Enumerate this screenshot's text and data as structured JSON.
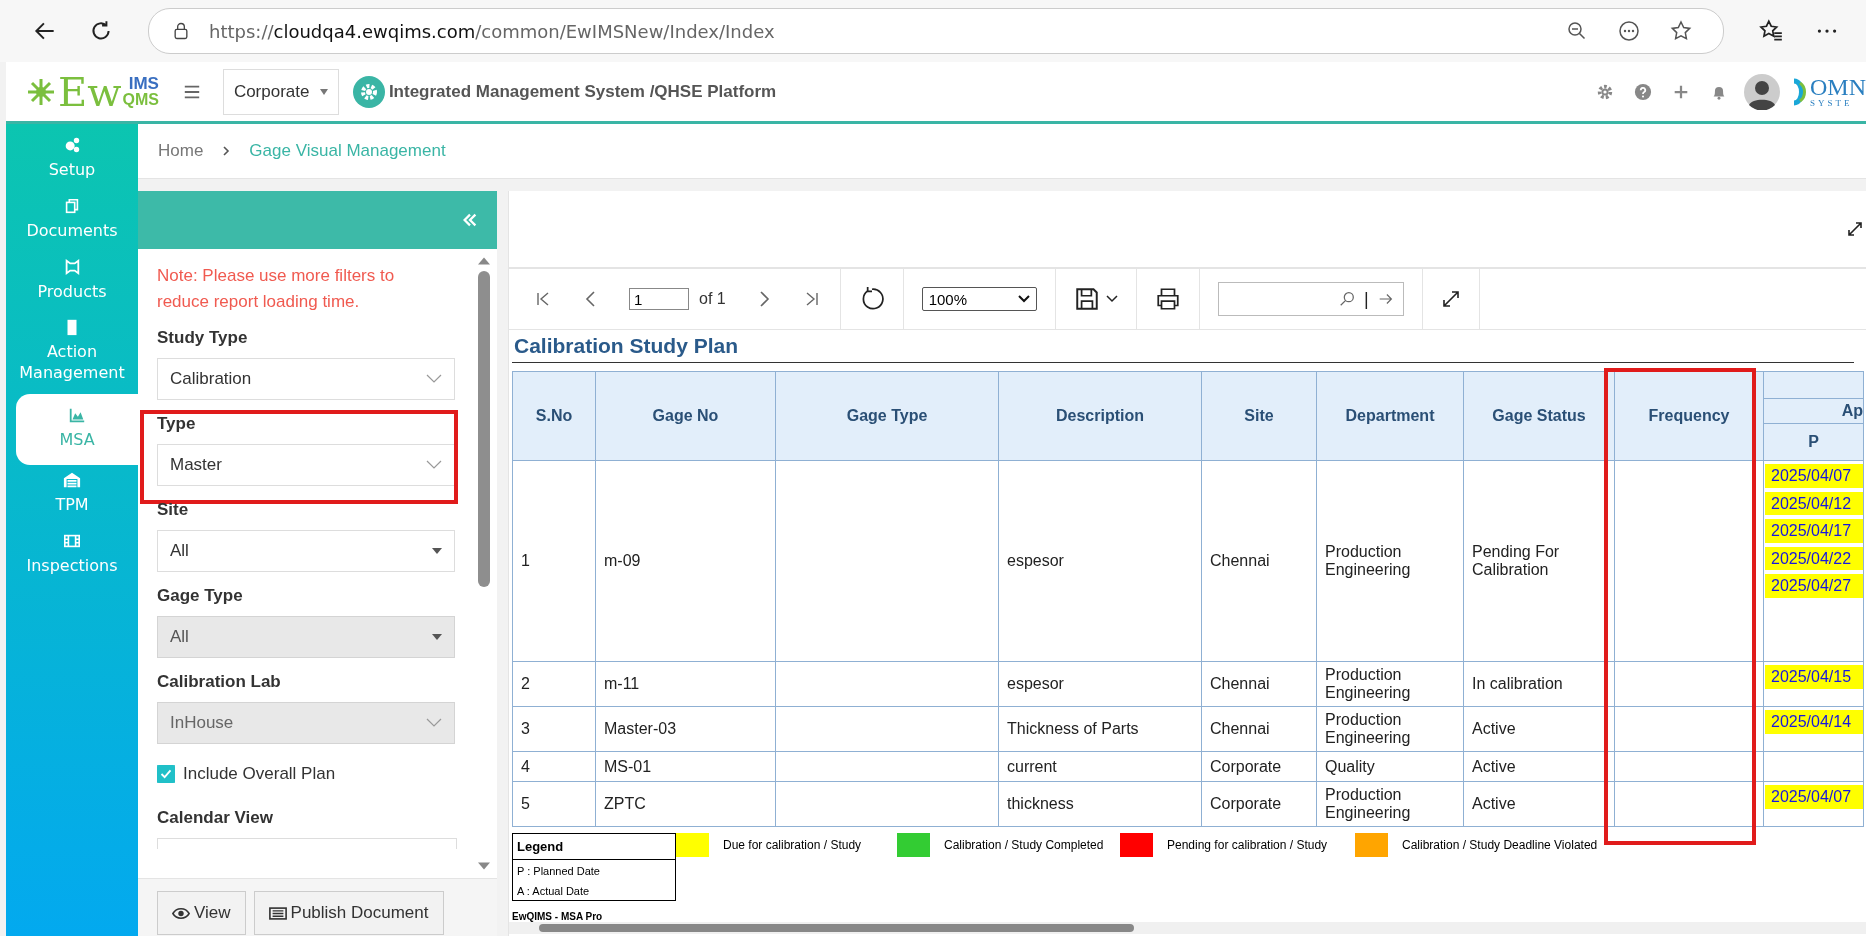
{
  "browser": {
    "url": {
      "scheme": "https://",
      "host": "cloudqa4.ewqims.com",
      "path": "/common/EwIMSNew/Index/Index"
    }
  },
  "header": {
    "logo": {
      "main": "Ew",
      "top": "IMS",
      "bottom": "QMS"
    },
    "company": "Corporate",
    "title": "Integrated Management System /QHSE Platform",
    "partner_logo": {
      "top": "OMN",
      "bottom": "SYSTE"
    }
  },
  "nav": [
    {
      "label": "Setup",
      "selected": false
    },
    {
      "label": "Documents",
      "selected": false
    },
    {
      "label": "Products",
      "selected": false
    },
    {
      "label": "Action Management",
      "selected": false
    },
    {
      "label": "MSA",
      "selected": true
    },
    {
      "label": "TPM",
      "selected": false
    },
    {
      "label": "Inspections",
      "selected": false
    }
  ],
  "breadcrumb": [
    "Home",
    "Gage Visual Management"
  ],
  "filters": {
    "note": "Note: Please use more filters to reduce report loading time.",
    "fields": [
      {
        "label": "Study Type",
        "value": "Calibration",
        "kind": "combo",
        "disabled": false,
        "highlighted": false
      },
      {
        "label": "Type",
        "value": "Master",
        "kind": "combo",
        "disabled": false,
        "highlighted": true
      },
      {
        "label": "Site",
        "value": "All",
        "kind": "select",
        "disabled": false,
        "highlighted": false
      },
      {
        "label": "Gage Type",
        "value": "All",
        "kind": "select",
        "disabled": true,
        "highlighted": false
      },
      {
        "label": "Calibration Lab",
        "value": "InHouse",
        "kind": "combo",
        "disabled": true,
        "highlighted": false
      }
    ],
    "include_overall_plan": {
      "label": "Include Overall Plan",
      "checked": true
    },
    "calendar_view": {
      "label": "Calendar View"
    },
    "buttons": [
      "View",
      "Publish Document"
    ]
  },
  "report": {
    "toolbar": {
      "page": "1",
      "of": "of 1",
      "zoom": "100%",
      "search_separator": "|"
    },
    "title": "Calibration Study Plan",
    "columns": [
      {
        "label": "S.No",
        "highlighted": false
      },
      {
        "label": "Gage No",
        "highlighted": false
      },
      {
        "label": "Gage Type",
        "highlighted": false
      },
      {
        "label": "Description",
        "highlighted": false
      },
      {
        "label": "Site",
        "highlighted": false
      },
      {
        "label": "Department",
        "highlighted": false
      },
      {
        "label": "Gage Status",
        "highlighted": false
      },
      {
        "label": "Frequency",
        "highlighted": true
      }
    ],
    "month": {
      "label": "Ap",
      "sub": "P"
    },
    "rows": [
      {
        "sno": "1",
        "gage_no": "m-09",
        "description": "espesor",
        "site": "Chennai",
        "department": "Production Engineering",
        "status": "Pending For Calibration",
        "planned": [
          "2025/04/07",
          "2025/04/12",
          "2025/04/17",
          "2025/04/22",
          "2025/04/27"
        ]
      },
      {
        "sno": "2",
        "gage_no": "m-11",
        "description": "espesor",
        "site": "Chennai",
        "department": "Production Engineering",
        "status": "In calibration",
        "planned": [
          "2025/04/15"
        ]
      },
      {
        "sno": "3",
        "gage_no": "Master-03",
        "description": "Thickness of Parts",
        "site": "Chennai",
        "department": "Production Engineering",
        "status": "Active",
        "planned": [
          "2025/04/14"
        ]
      },
      {
        "sno": "4",
        "gage_no": "MS-01",
        "description": "current",
        "site": "Corporate",
        "department": "Quality",
        "status": "Active",
        "planned": []
      },
      {
        "sno": "5",
        "gage_no": "ZPTC",
        "description": "thickness",
        "site": "Corporate",
        "department": "Production Engineering",
        "status": "Active",
        "planned": [
          "2025/04/07"
        ]
      }
    ],
    "legend": {
      "title": "Legend",
      "notes": [
        "P : Planned Date",
        "A : Actual Date"
      ],
      "items": [
        {
          "label": "Due for calibration / Study",
          "color": "#ffff00"
        },
        {
          "label": "Calibration / Study Completed",
          "color": "#33cc33"
        },
        {
          "label": "Pending for calibration / Study",
          "color": "#ff0000"
        },
        {
          "label": "Calibration / Study Deadline Violated",
          "color": "#ffa500"
        }
      ]
    },
    "footer": "EwQIMS - MSA Pro"
  }
}
